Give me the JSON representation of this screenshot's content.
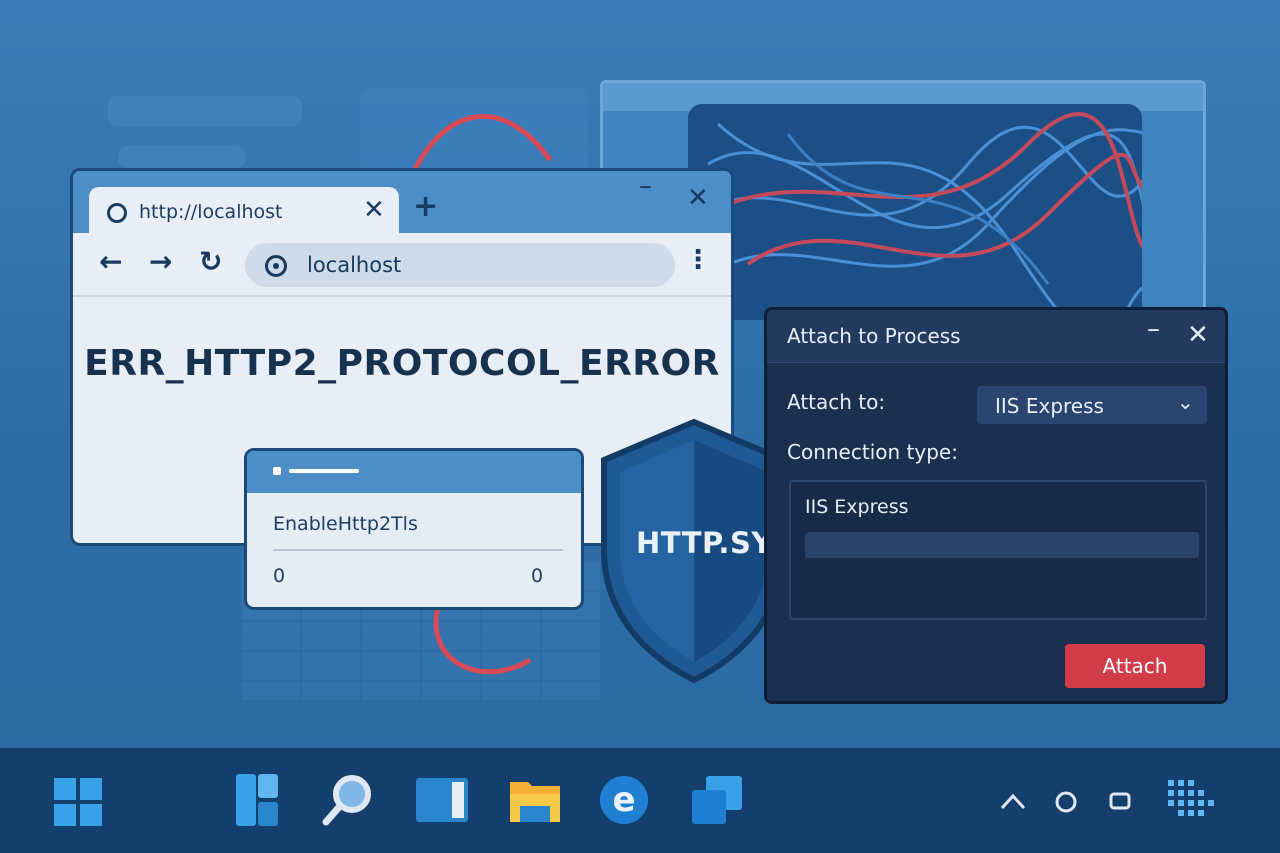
{
  "browser": {
    "tab_title": "http://localhost",
    "tab_close": "✕",
    "new_tab": "+",
    "window_minimize": "–",
    "window_close": "✕",
    "back": "←",
    "forward": "→",
    "reload": "↻",
    "address": "localhost",
    "menu": "⋮",
    "error_code": "ERR_HTTP2_PROTOCOL_ERROR"
  },
  "registry_card": {
    "value_name": "EnableHttp2Tls",
    "value_left": "0",
    "value_right": "0"
  },
  "shield": {
    "label": "HTTP.SYS"
  },
  "attach_dialog": {
    "title": "Attach to Process",
    "minimize": "–",
    "close": "✕",
    "attach_to_label": "Attach to:",
    "attach_to_value": "IIS Express",
    "connection_type_label": "Connection type:",
    "list_item": "IIS Express",
    "attach_button": "Attach"
  },
  "taskbar": {
    "icons": [
      "start-icon",
      "widgets-icon",
      "search-icon",
      "task-view-icon",
      "file-explorer-icon",
      "edge-icon",
      "store-icon",
      "chevron-up-icon",
      "circle-icon",
      "square-icon",
      "grid-icon"
    ]
  },
  "colors": {
    "background": "#2f6fa8",
    "taskbar": "#143e6b",
    "attach_button": "#d23c48",
    "dialog": "#1b2f4f",
    "accent_red_line": "#d84a55"
  }
}
